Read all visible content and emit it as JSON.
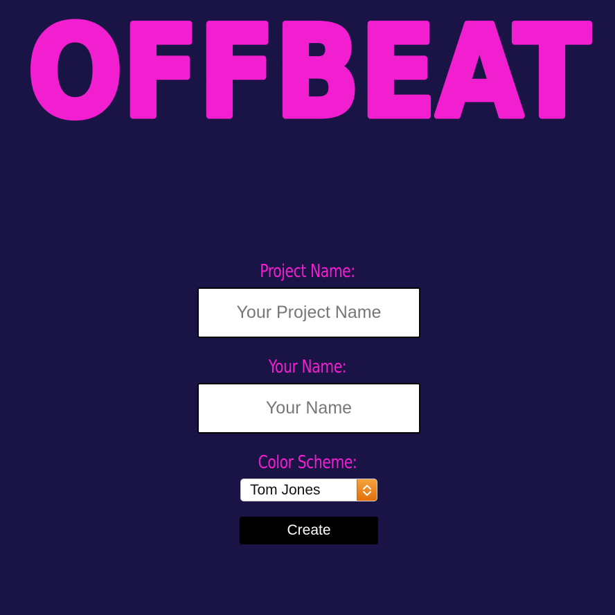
{
  "logo": {
    "text": "OFFBEAT",
    "color": "#f21fd0"
  },
  "form": {
    "project_name": {
      "label": "Project Name:",
      "placeholder": "Your Project Name",
      "value": ""
    },
    "your_name": {
      "label": "Your Name:",
      "placeholder": "Your Name",
      "value": ""
    },
    "color_scheme": {
      "label": "Color Scheme:",
      "selected": "Tom Jones"
    },
    "submit_label": "Create"
  },
  "colors": {
    "background": "#1a1446",
    "accent": "#f21fd0",
    "button": "#000000",
    "stepper": "#f08a1f"
  },
  "icons": {
    "select_stepper": "chevron-up-down-icon"
  }
}
